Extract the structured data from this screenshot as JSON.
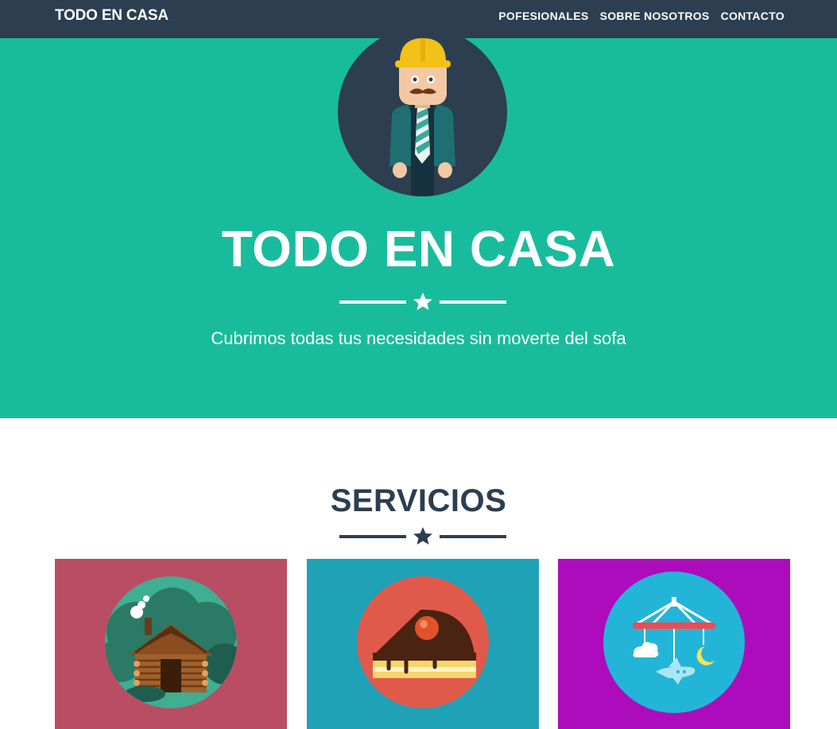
{
  "navbar": {
    "brand": "TODO EN CASA",
    "links": [
      "POFESIONALES",
      "SOBRE NOSOTROS",
      "CONTACTO"
    ]
  },
  "hero": {
    "title": "TODO EN CASA",
    "subtitle": "Cubrimos todas tus necesidades sin moverte del sofa",
    "avatar_icon": "construction-worker-icon"
  },
  "services": {
    "title": "SERVICIOS",
    "cards": [
      {
        "icon": "log-cabin-icon",
        "background": "#b94d64",
        "circle": "#3fae93"
      },
      {
        "icon": "cake-slice-icon",
        "background": "#1fa2b6",
        "circle": "#e05a4b"
      },
      {
        "icon": "baby-mobile-icon",
        "background": "#ad0cbc",
        "circle": "#23b5d8"
      }
    ]
  },
  "colors": {
    "navbar": "#2c3e50",
    "hero": "#18bc9c",
    "heading": "#2c3e50",
    "white": "#ffffff"
  }
}
